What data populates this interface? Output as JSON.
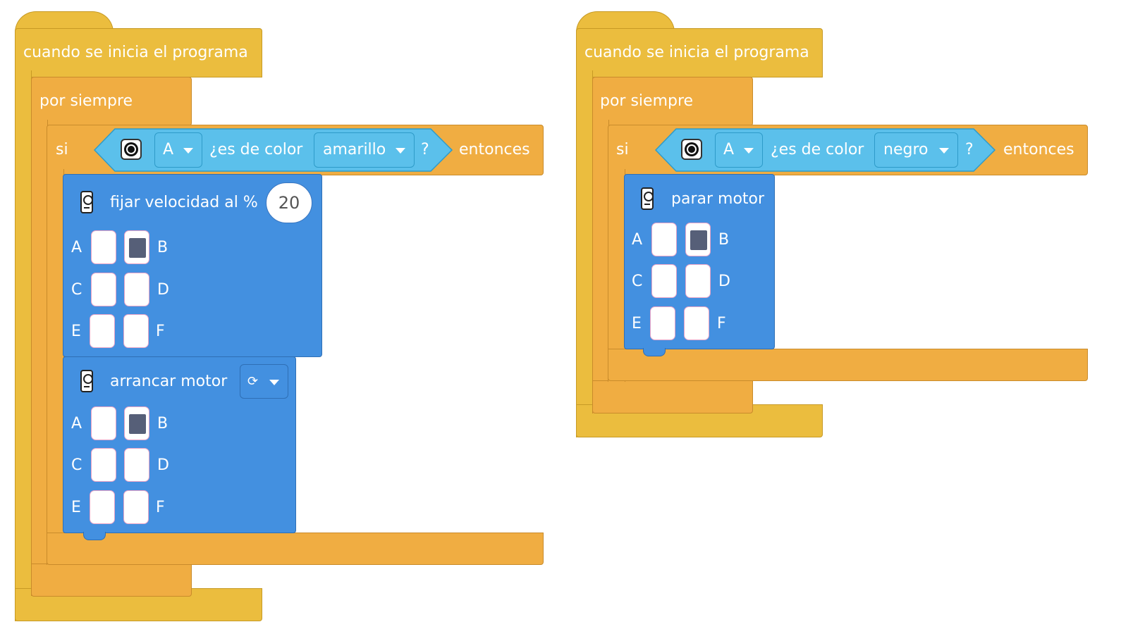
{
  "colors": {
    "events": "#ebbd3e",
    "control": "#f0ad42",
    "sensor": "#5bc0eb",
    "motor": "#4390e0",
    "port_selected": "#565f78"
  },
  "scripts": [
    {
      "hat": "cuando se inicia el programa",
      "loop": "por siempre",
      "if_label": "si",
      "then_label": "entonces",
      "condition": {
        "port": "A",
        "text": "¿es de color",
        "color": "amarillo",
        "q": "?",
        "icon": "color-sensor-icon"
      },
      "blocks": [
        {
          "label": "fijar velocidad al %",
          "value": "20",
          "ports": [
            {
              "l": "A",
              "r": "B"
            },
            {
              "l": "C",
              "r": "D"
            },
            {
              "l": "E",
              "r": "F"
            }
          ],
          "selected": "B"
        },
        {
          "label": "arrancar motor",
          "direction": "⟳",
          "ports": [
            {
              "l": "A",
              "r": "B"
            },
            {
              "l": "C",
              "r": "D"
            },
            {
              "l": "E",
              "r": "F"
            }
          ],
          "selected": "B"
        }
      ]
    },
    {
      "hat": "cuando se inicia el programa",
      "loop": "por siempre",
      "if_label": "si",
      "then_label": "entonces",
      "condition": {
        "port": "A",
        "text": "¿es de color",
        "color": "negro",
        "q": "?",
        "icon": "color-sensor-icon"
      },
      "blocks": [
        {
          "label": "parar motor",
          "ports": [
            {
              "l": "A",
              "r": "B"
            },
            {
              "l": "C",
              "r": "D"
            },
            {
              "l": "E",
              "r": "F"
            }
          ],
          "selected": "B"
        }
      ]
    }
  ]
}
